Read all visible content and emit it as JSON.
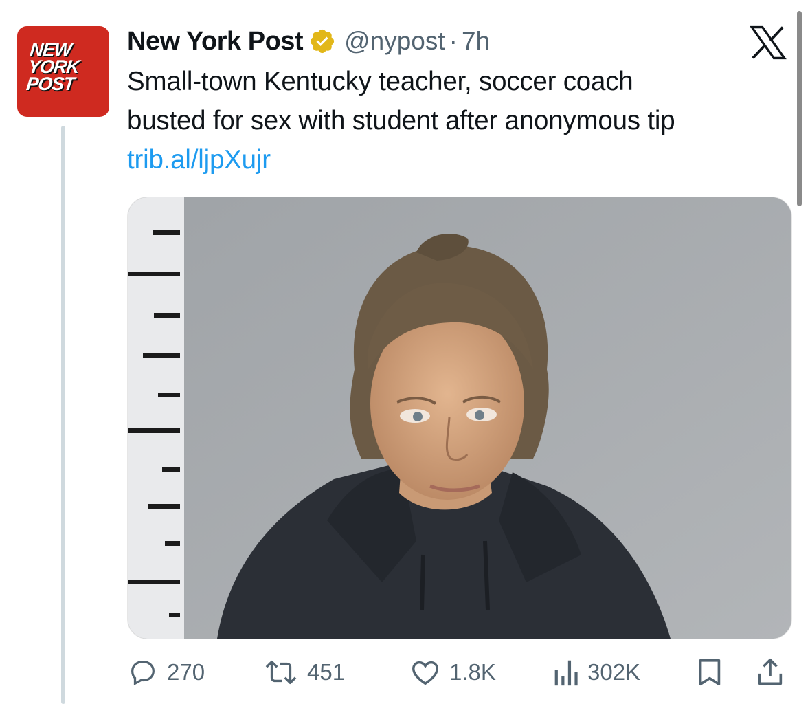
{
  "account": {
    "avatar_logo": [
      "NEW",
      "YORK",
      "POST"
    ],
    "display_name": "New York Post",
    "handle": "@nypost",
    "separator": "·",
    "time": "7h",
    "verified_color": "#e2b719"
  },
  "tweet": {
    "text_lines": [
      "Small-town Kentucky teacher, soccer coach",
      "busted for sex with student after anonymous tip"
    ],
    "link": "trib.al/ljpXujr"
  },
  "media": {
    "type": "photo",
    "description_icon": "mugshot-photo"
  },
  "actions": {
    "reply_count": "270",
    "retweet_count": "451",
    "like_count": "1.8K",
    "views_count": "302K"
  },
  "colors": {
    "accent": "#1d9bf0",
    "secondary_text": "#536471",
    "brand_red": "#cf2a20"
  }
}
